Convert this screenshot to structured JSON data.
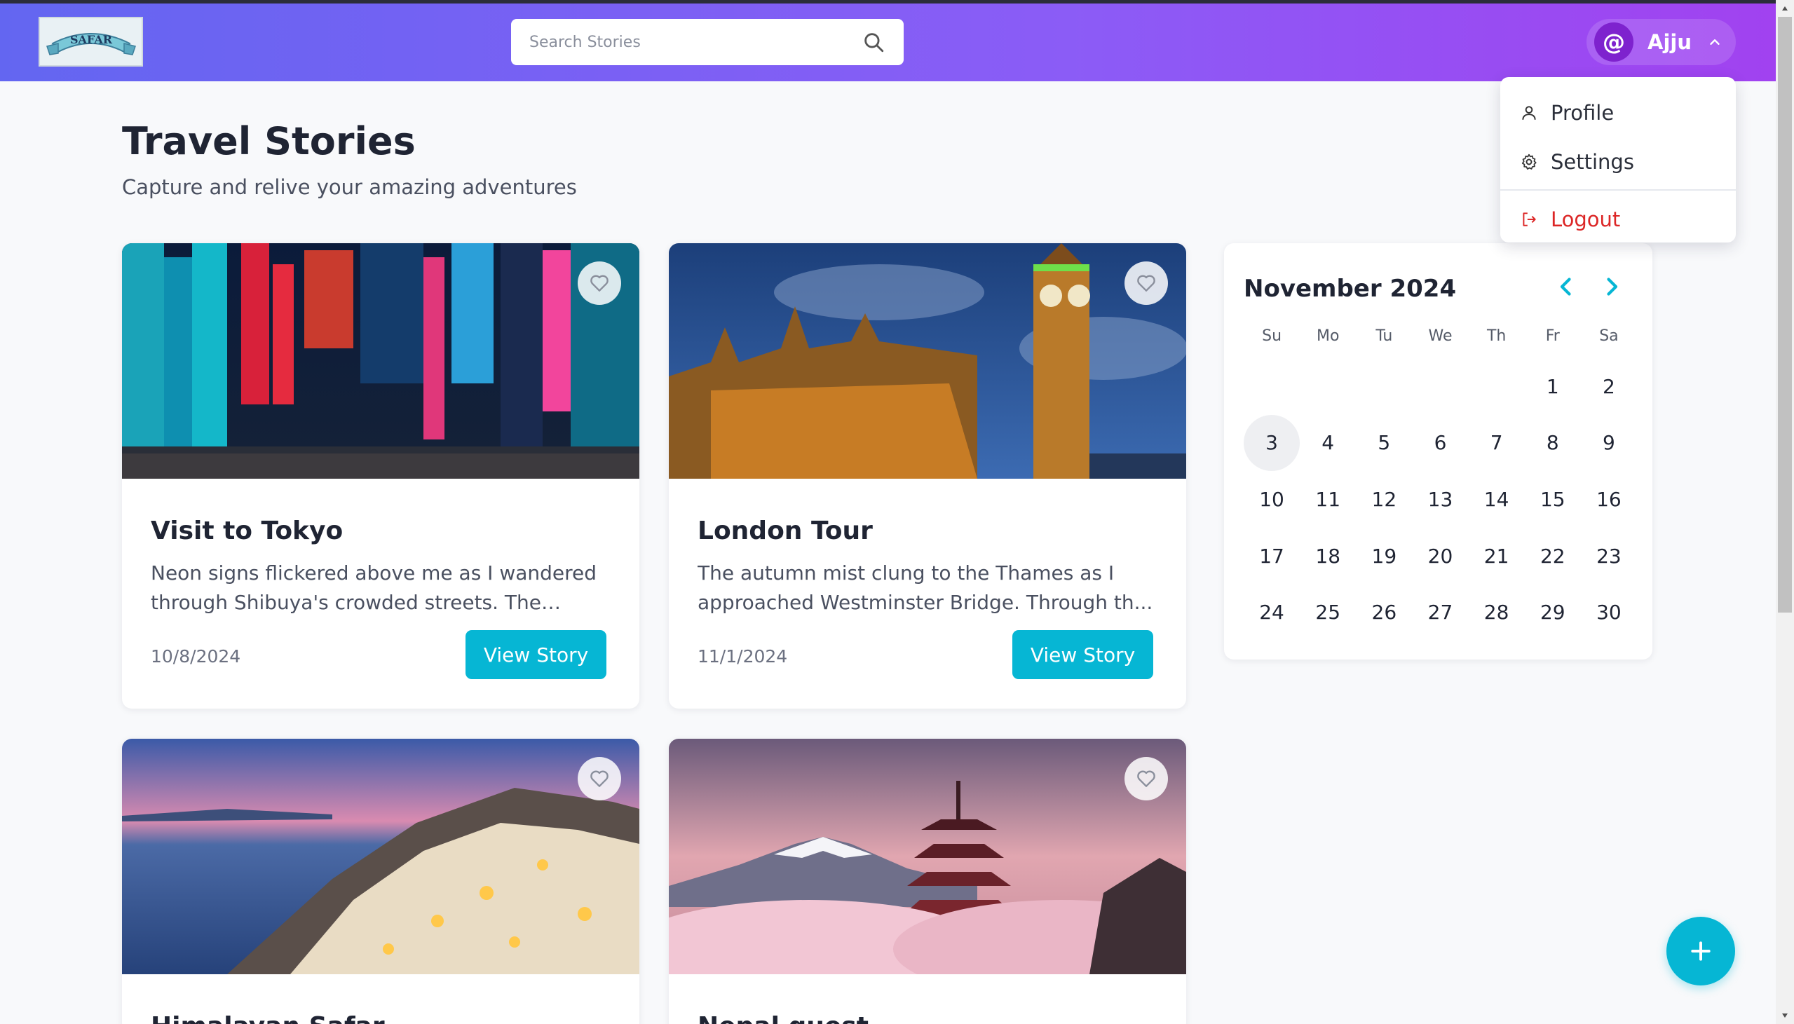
{
  "header": {
    "logo_text": "SAFAR",
    "search_placeholder": "Search Stories",
    "user_initial": "@",
    "user_name": "Ajju"
  },
  "user_menu": {
    "items": [
      {
        "label": "Profile",
        "icon": "user-icon"
      },
      {
        "label": "Settings",
        "icon": "gear-icon"
      },
      {
        "label": "Logout",
        "icon": "logout-icon"
      }
    ]
  },
  "page": {
    "title": "Travel Stories",
    "subtitle": "Capture and relive your amazing adventures"
  },
  "stories": [
    {
      "title": "Visit to Tokyo",
      "excerpt": "Neon signs flickered above me as I wandered through Shibuya's crowded streets. The scent...",
      "date": "10/8/2024",
      "button": "View Story"
    },
    {
      "title": "London Tour",
      "excerpt": "The autumn mist clung to the Thames as I approached Westminster Bridge. Through th...",
      "date": "11/1/2024",
      "button": "View Story"
    },
    {
      "title": "Himalayan Safar",
      "excerpt": "",
      "date": "",
      "button": ""
    },
    {
      "title": "Nepal quest",
      "excerpt": "",
      "date": "",
      "button": ""
    }
  ],
  "calendar": {
    "month_label": "November 2024",
    "weekdays": [
      "Su",
      "Mo",
      "Tu",
      "We",
      "Th",
      "Fr",
      "Sa"
    ],
    "weeks": [
      [
        "",
        "",
        "",
        "",
        "",
        "1",
        "2"
      ],
      [
        "3",
        "4",
        "5",
        "6",
        "7",
        "8",
        "9"
      ],
      [
        "10",
        "11",
        "12",
        "13",
        "14",
        "15",
        "16"
      ],
      [
        "17",
        "18",
        "19",
        "20",
        "21",
        "22",
        "23"
      ],
      [
        "24",
        "25",
        "26",
        "27",
        "28",
        "29",
        "30"
      ]
    ],
    "highlighted_day": "3"
  },
  "colors": {
    "accent": "#06b6d4",
    "header_gradient_start": "#6366f1",
    "header_gradient_end": "#a142f0",
    "logout": "#dc2626"
  },
  "fab_icon": "plus-icon"
}
